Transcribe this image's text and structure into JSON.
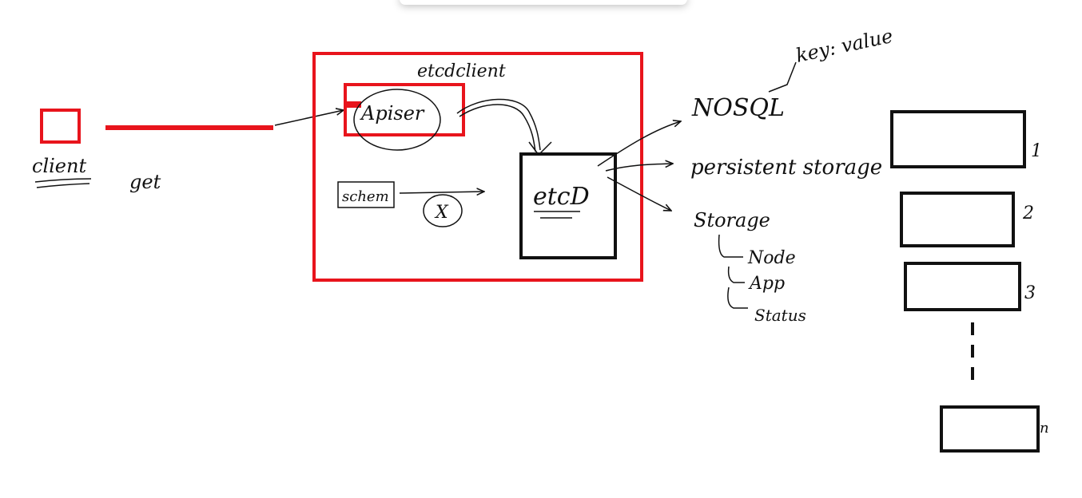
{
  "colors": {
    "ink": "#111111",
    "accent": "#e8141c",
    "background": "#ffffff"
  },
  "labels": {
    "client": "client",
    "get": "get",
    "etcd_client": "etcdclient",
    "apiserver": "Apiser",
    "schema": "schem",
    "x_mark": "X",
    "etcd": "etcD",
    "nosql": "NOSQL",
    "key_value": "key: value",
    "persistent_storage": "persistent storage",
    "storage": "Storage",
    "node": "Node",
    "app": "App",
    "status": "Status"
  },
  "stack": {
    "labels": [
      "1",
      "2",
      "3",
      "n"
    ]
  }
}
